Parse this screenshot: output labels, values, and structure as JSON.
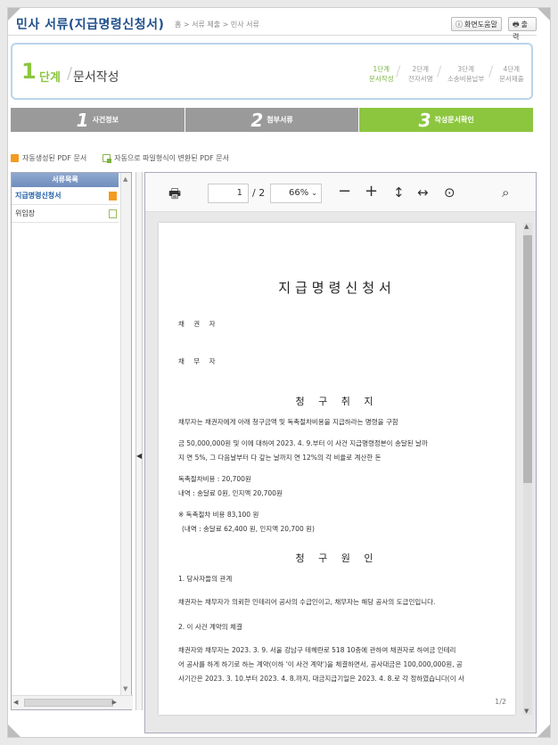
{
  "header": {
    "title": "민사 서류(지급명령신청서)",
    "breadcrumb": "홈 > 서류 제출 > 민사 서류",
    "help_btn": "화면도움말",
    "print_btn": "출력"
  },
  "step": {
    "num": "1",
    "dan": "단계",
    "name": "문서작성",
    "items": [
      {
        "line1": "1단계",
        "line2": "문서작성"
      },
      {
        "line1": "2단계",
        "line2": "전자서명"
      },
      {
        "line1": "3단계",
        "line2": "소송비용납부"
      },
      {
        "line1": "4단계",
        "line2": "문서제출"
      }
    ]
  },
  "tabs": [
    {
      "num": "1",
      "label": "사건정보"
    },
    {
      "num": "2",
      "label": "첨부서류"
    },
    {
      "num": "3",
      "label": "작성문서확인"
    }
  ],
  "pdflinks": {
    "auto": "자동생성된 PDF 문서",
    "converted": "자동으로 파일형식이 변환된 PDF 문서"
  },
  "left_panel": {
    "head": "서류목록",
    "items": [
      "지급명령신청서",
      "위임장"
    ]
  },
  "viewer": {
    "page_input": "1",
    "page_total": "/ 2",
    "zoom": "66%",
    "page_indicator": "1/2"
  },
  "doc": {
    "title": "지급명령신청서",
    "creditor_label": "채 권 자",
    "debtor_label": "채 무 자",
    "claim_title": "청 구 취 지",
    "claim_lines": [
      "채무자는 채권자에게 아래 청구금액 및 독촉절차비용을 지급하라는 명령을 구함",
      "금 50,000,000원 및 이에 대하여 2023. 4. 9.부터 이 사건 지급명령정본이 송달된 날까",
      "지 연 5%, 그 다음날부터 다 갚는 날까지 연 12%의 각 비율로 계산한 돈",
      "독촉절차비용 : 20,700원",
      "내역 : 송달료 0원, 인지액 20,700원",
      "※ 독촉절차 비용 83,100 원",
      "(내역 : 송달료 62,400 원, 인지액 20,700 원)"
    ],
    "cause_title": "청 구 원 인",
    "cause_lines": [
      "1. 당사자들의 관계",
      "채권자는 채무자가 의뢰한 인테리어 공사의 수급인이고, 채무자는 해당 공사의 도급인입니다.",
      "2. 이 사건 계약의 체결",
      "채권자와 채무자는 2023. 3. 9. 서울 강남구 테헤란로 518 10층에 관하여 채권자로 하여금 인테리",
      "어 공사를 하게 하기로 하는 계약(이하 '이 사건 계약')을 체결하면서, 공사대금은 100,000,000원, 공",
      "사기간은 2023. 3. 10.부터 2023. 4. 8.까지, 대금지급기일은 2023. 4. 8.로 각 정하였습니다(이 사"
    ]
  }
}
